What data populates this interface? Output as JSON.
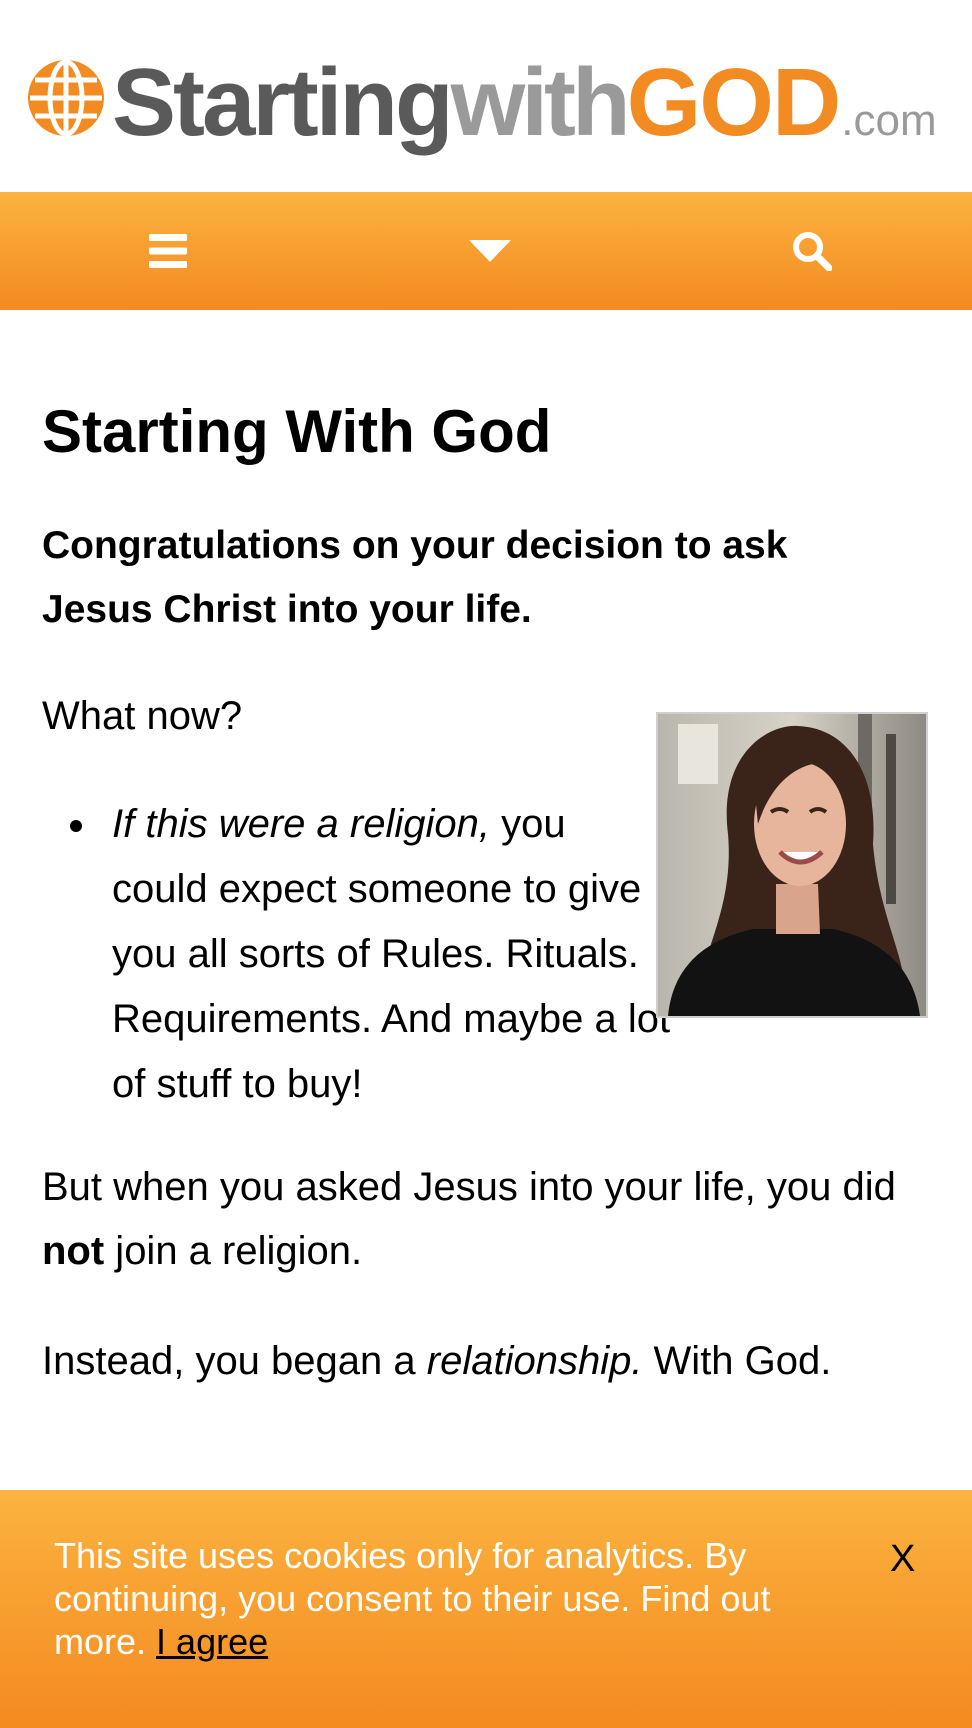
{
  "brand": {
    "part_starting": "Starting",
    "part_with": "with",
    "part_god": "GOD",
    "part_tld": ".com",
    "colors": {
      "gray": "#5a5a5a",
      "light_gray": "#9a9a9a",
      "orange": "#f28b22"
    }
  },
  "nav": {
    "icons": [
      "hamburger-menu-icon",
      "caret-down-icon",
      "search-icon"
    ],
    "bar_gradient": [
      "#fbb33f",
      "#f48a21"
    ]
  },
  "article": {
    "title": "Starting With God",
    "lead": "Congratulations on your decision to ask Jesus Christ into your life.",
    "what_now": "What now?",
    "bullet": {
      "italic": "If this were a religion,",
      "rest": " you could expect someone to give you all sorts of Rules. Rituals. Requirements. And maybe a lot of stuff to buy!"
    },
    "but_para": {
      "before": "But when you asked Jesus into your life, you did ",
      "bold": "not",
      "after": " join a religion."
    },
    "instead": {
      "before": "Instead, you began a ",
      "italic": "relationship.",
      "after": " With God."
    },
    "photo": "smiling-woman-photo"
  },
  "cookie": {
    "text": "This site uses cookies only for analytics. By continuing, you consent to their use. Find out more.",
    "agree": "I agree",
    "close": "X"
  }
}
